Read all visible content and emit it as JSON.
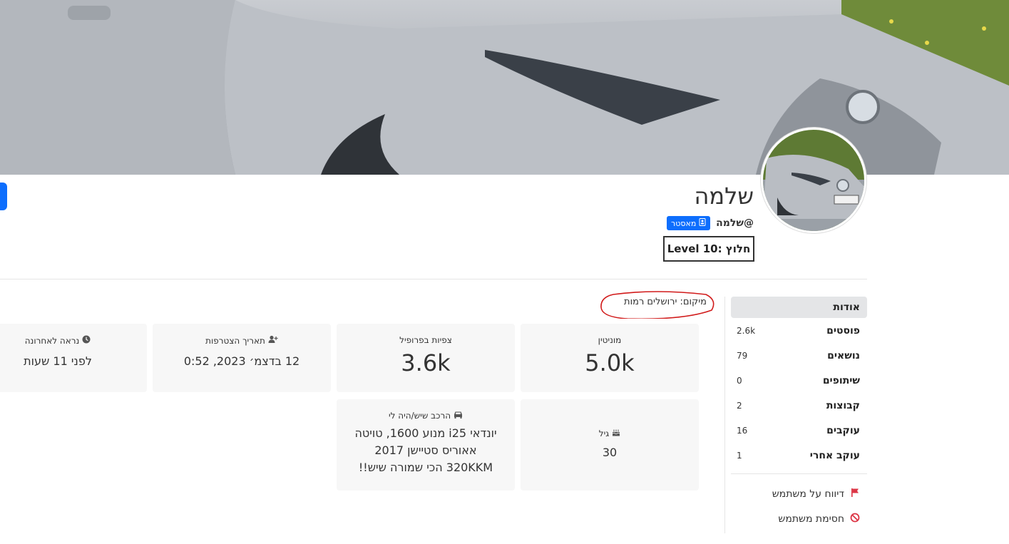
{
  "profile": {
    "display_name": "שלמה",
    "username": "@שלמה",
    "badge_label": "מאסטר",
    "level_label": "Level 10: חלוץ"
  },
  "location_text": "מיקום: ירושלים רמות",
  "stats": [
    {
      "label": "מוניטין",
      "value": "5.0k"
    },
    {
      "label": "צפיות בפרופיל",
      "value": "3.6k"
    },
    {
      "label": "תאריך הצטרפות",
      "value": "12 בדצמ׳ 2023, 0:52"
    },
    {
      "label": "נראה לאחרונה",
      "value": "לפני 11 שעות"
    }
  ],
  "info": [
    {
      "label": "גיל",
      "value": "30"
    },
    {
      "label": "הרכב שיש/היה לי",
      "value": "יונדאי i25 מנוע 1600, טויטה אאוריס סטיישן 2017 320KKM הכי שמורה שיש!!"
    }
  ],
  "sidebar": {
    "items": [
      {
        "label": "אודות",
        "count": ""
      },
      {
        "label": "פוסטים",
        "count": "2.6k"
      },
      {
        "label": "נושאים",
        "count": "79"
      },
      {
        "label": "שיתופים",
        "count": "0"
      },
      {
        "label": "קבוצות",
        "count": "2"
      },
      {
        "label": "עוקבים",
        "count": "16"
      },
      {
        "label": "עוקב אחרי",
        "count": "1"
      }
    ],
    "actions": [
      {
        "label": "דיווח על משתמש",
        "icon": "flag-icon",
        "color": "#dc3545"
      },
      {
        "label": "חסימת משתמש",
        "icon": "ban-icon",
        "color": "#dc3545"
      }
    ]
  },
  "colors": {
    "accent": "#0d6efd",
    "danger": "#dc3545",
    "annotation": "#d11a1a"
  }
}
